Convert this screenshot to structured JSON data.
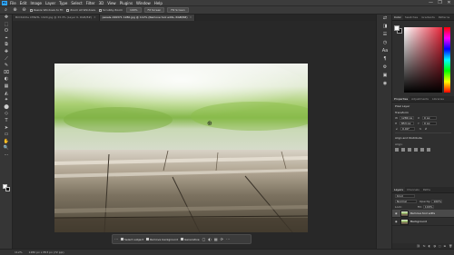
{
  "menubar": {
    "logo": "Ps",
    "items": [
      "File",
      "Edit",
      "Image",
      "Layer",
      "Type",
      "Select",
      "Filter",
      "3D",
      "View",
      "Plugins",
      "Window",
      "Help"
    ],
    "window_controls": [
      "—",
      "❐",
      "✕"
    ]
  },
  "options": {
    "tool_icon": "zoom-icon",
    "buttons": [
      "Resize Windows to Fit",
      "Zoom All Windows",
      "Scrubby Zoom",
      "100%",
      "Fit Screen",
      "Fill Screen"
    ],
    "checks": []
  },
  "tabs": [
    {
      "label": "Bill Riddle CMW3L 1920.jpg @ 33.3% (Layer 0, RGB/8#)",
      "active": false
    },
    {
      "label": "pexels-199371 1280.jpg @ 112% (Remove tool edits, RGB/8#)",
      "active": true
    }
  ],
  "tools": [
    "✥",
    "⬚",
    "ʘ",
    "⌖",
    "⧉",
    "✚",
    "⟋",
    "✎",
    "⌧",
    "◐",
    "▦",
    "◭",
    "✦",
    "⬤",
    "◇",
    "T",
    "➤",
    "▭",
    "✋",
    "🔍",
    "⋯"
  ],
  "status": {
    "zoom": "112%",
    "size": "1280 px x 853 px (72 ppi)"
  },
  "taskbar": {
    "items": [
      "Select subject",
      "Remove background",
      "Generative"
    ],
    "small_icons": [
      "⋯",
      "▢",
      "◐",
      "▦",
      "⟳",
      "⋯"
    ]
  },
  "dock_icons": [
    "⇄",
    "◨",
    "☰",
    "◷",
    "Aa",
    "¶",
    "⚙",
    "▣",
    "◉"
  ],
  "color_panel": {
    "tabs": [
      "Color",
      "Swatches",
      "Gradients",
      "Patterns"
    ],
    "fg_color": "#fafafa",
    "bg_color": "#111111",
    "hue_color": "#e8283c"
  },
  "properties_panel": {
    "tabs": [
      "Properties",
      "Adjustments",
      "Libraries"
    ],
    "layer_kind": "Pixel Layer",
    "transform_label": "Transform",
    "w": "1280 px",
    "h": "853 px",
    "x": "0 px",
    "y": "0 px",
    "angle": "0.00°",
    "align_label": "Align and Distribute",
    "align_sub": "Align:"
  },
  "layers_panel": {
    "tabs": [
      "Layers",
      "Channels",
      "Paths"
    ],
    "kind_filter": "Kind",
    "blend_mode": "Normal",
    "opacity_label": "Opacity:",
    "opacity": "100%",
    "lock_label": "Lock:",
    "fill_label": "Fill:",
    "fill": "100%",
    "layers": [
      {
        "name": "Remove tool edits",
        "selected": true
      },
      {
        "name": "Background",
        "selected": false
      }
    ],
    "footer_icons": [
      "⛓",
      "fx",
      "◐",
      "◑",
      "▢",
      "⊞",
      "🗑"
    ]
  }
}
